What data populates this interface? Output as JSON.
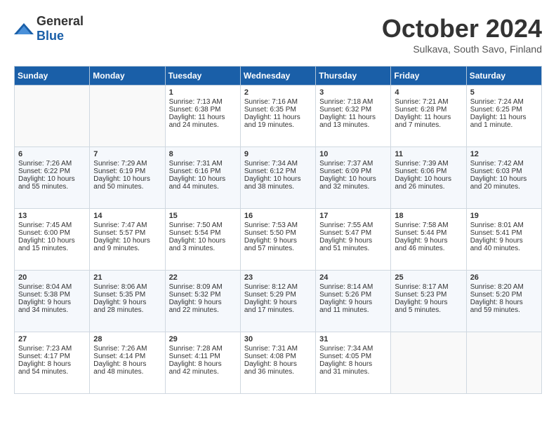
{
  "header": {
    "logo_general": "General",
    "logo_blue": "Blue",
    "month_title": "October 2024",
    "subtitle": "Sulkava, South Savo, Finland"
  },
  "weekdays": [
    "Sunday",
    "Monday",
    "Tuesday",
    "Wednesday",
    "Thursday",
    "Friday",
    "Saturday"
  ],
  "weeks": [
    [
      {
        "day": "",
        "lines": []
      },
      {
        "day": "",
        "lines": []
      },
      {
        "day": "1",
        "lines": [
          "Sunrise: 7:13 AM",
          "Sunset: 6:38 PM",
          "Daylight: 11 hours",
          "and 24 minutes."
        ]
      },
      {
        "day": "2",
        "lines": [
          "Sunrise: 7:16 AM",
          "Sunset: 6:35 PM",
          "Daylight: 11 hours",
          "and 19 minutes."
        ]
      },
      {
        "day": "3",
        "lines": [
          "Sunrise: 7:18 AM",
          "Sunset: 6:32 PM",
          "Daylight: 11 hours",
          "and 13 minutes."
        ]
      },
      {
        "day": "4",
        "lines": [
          "Sunrise: 7:21 AM",
          "Sunset: 6:28 PM",
          "Daylight: 11 hours",
          "and 7 minutes."
        ]
      },
      {
        "day": "5",
        "lines": [
          "Sunrise: 7:24 AM",
          "Sunset: 6:25 PM",
          "Daylight: 11 hours",
          "and 1 minute."
        ]
      }
    ],
    [
      {
        "day": "6",
        "lines": [
          "Sunrise: 7:26 AM",
          "Sunset: 6:22 PM",
          "Daylight: 10 hours",
          "and 55 minutes."
        ]
      },
      {
        "day": "7",
        "lines": [
          "Sunrise: 7:29 AM",
          "Sunset: 6:19 PM",
          "Daylight: 10 hours",
          "and 50 minutes."
        ]
      },
      {
        "day": "8",
        "lines": [
          "Sunrise: 7:31 AM",
          "Sunset: 6:16 PM",
          "Daylight: 10 hours",
          "and 44 minutes."
        ]
      },
      {
        "day": "9",
        "lines": [
          "Sunrise: 7:34 AM",
          "Sunset: 6:12 PM",
          "Daylight: 10 hours",
          "and 38 minutes."
        ]
      },
      {
        "day": "10",
        "lines": [
          "Sunrise: 7:37 AM",
          "Sunset: 6:09 PM",
          "Daylight: 10 hours",
          "and 32 minutes."
        ]
      },
      {
        "day": "11",
        "lines": [
          "Sunrise: 7:39 AM",
          "Sunset: 6:06 PM",
          "Daylight: 10 hours",
          "and 26 minutes."
        ]
      },
      {
        "day": "12",
        "lines": [
          "Sunrise: 7:42 AM",
          "Sunset: 6:03 PM",
          "Daylight: 10 hours",
          "and 20 minutes."
        ]
      }
    ],
    [
      {
        "day": "13",
        "lines": [
          "Sunrise: 7:45 AM",
          "Sunset: 6:00 PM",
          "Daylight: 10 hours",
          "and 15 minutes."
        ]
      },
      {
        "day": "14",
        "lines": [
          "Sunrise: 7:47 AM",
          "Sunset: 5:57 PM",
          "Daylight: 10 hours",
          "and 9 minutes."
        ]
      },
      {
        "day": "15",
        "lines": [
          "Sunrise: 7:50 AM",
          "Sunset: 5:54 PM",
          "Daylight: 10 hours",
          "and 3 minutes."
        ]
      },
      {
        "day": "16",
        "lines": [
          "Sunrise: 7:53 AM",
          "Sunset: 5:50 PM",
          "Daylight: 9 hours",
          "and 57 minutes."
        ]
      },
      {
        "day": "17",
        "lines": [
          "Sunrise: 7:55 AM",
          "Sunset: 5:47 PM",
          "Daylight: 9 hours",
          "and 51 minutes."
        ]
      },
      {
        "day": "18",
        "lines": [
          "Sunrise: 7:58 AM",
          "Sunset: 5:44 PM",
          "Daylight: 9 hours",
          "and 46 minutes."
        ]
      },
      {
        "day": "19",
        "lines": [
          "Sunrise: 8:01 AM",
          "Sunset: 5:41 PM",
          "Daylight: 9 hours",
          "and 40 minutes."
        ]
      }
    ],
    [
      {
        "day": "20",
        "lines": [
          "Sunrise: 8:04 AM",
          "Sunset: 5:38 PM",
          "Daylight: 9 hours",
          "and 34 minutes."
        ]
      },
      {
        "day": "21",
        "lines": [
          "Sunrise: 8:06 AM",
          "Sunset: 5:35 PM",
          "Daylight: 9 hours",
          "and 28 minutes."
        ]
      },
      {
        "day": "22",
        "lines": [
          "Sunrise: 8:09 AM",
          "Sunset: 5:32 PM",
          "Daylight: 9 hours",
          "and 22 minutes."
        ]
      },
      {
        "day": "23",
        "lines": [
          "Sunrise: 8:12 AM",
          "Sunset: 5:29 PM",
          "Daylight: 9 hours",
          "and 17 minutes."
        ]
      },
      {
        "day": "24",
        "lines": [
          "Sunrise: 8:14 AM",
          "Sunset: 5:26 PM",
          "Daylight: 9 hours",
          "and 11 minutes."
        ]
      },
      {
        "day": "25",
        "lines": [
          "Sunrise: 8:17 AM",
          "Sunset: 5:23 PM",
          "Daylight: 9 hours",
          "and 5 minutes."
        ]
      },
      {
        "day": "26",
        "lines": [
          "Sunrise: 8:20 AM",
          "Sunset: 5:20 PM",
          "Daylight: 8 hours",
          "and 59 minutes."
        ]
      }
    ],
    [
      {
        "day": "27",
        "lines": [
          "Sunrise: 7:23 AM",
          "Sunset: 4:17 PM",
          "Daylight: 8 hours",
          "and 54 minutes."
        ]
      },
      {
        "day": "28",
        "lines": [
          "Sunrise: 7:26 AM",
          "Sunset: 4:14 PM",
          "Daylight: 8 hours",
          "and 48 minutes."
        ]
      },
      {
        "day": "29",
        "lines": [
          "Sunrise: 7:28 AM",
          "Sunset: 4:11 PM",
          "Daylight: 8 hours",
          "and 42 minutes."
        ]
      },
      {
        "day": "30",
        "lines": [
          "Sunrise: 7:31 AM",
          "Sunset: 4:08 PM",
          "Daylight: 8 hours",
          "and 36 minutes."
        ]
      },
      {
        "day": "31",
        "lines": [
          "Sunrise: 7:34 AM",
          "Sunset: 4:05 PM",
          "Daylight: 8 hours",
          "and 31 minutes."
        ]
      },
      {
        "day": "",
        "lines": []
      },
      {
        "day": "",
        "lines": []
      }
    ]
  ]
}
